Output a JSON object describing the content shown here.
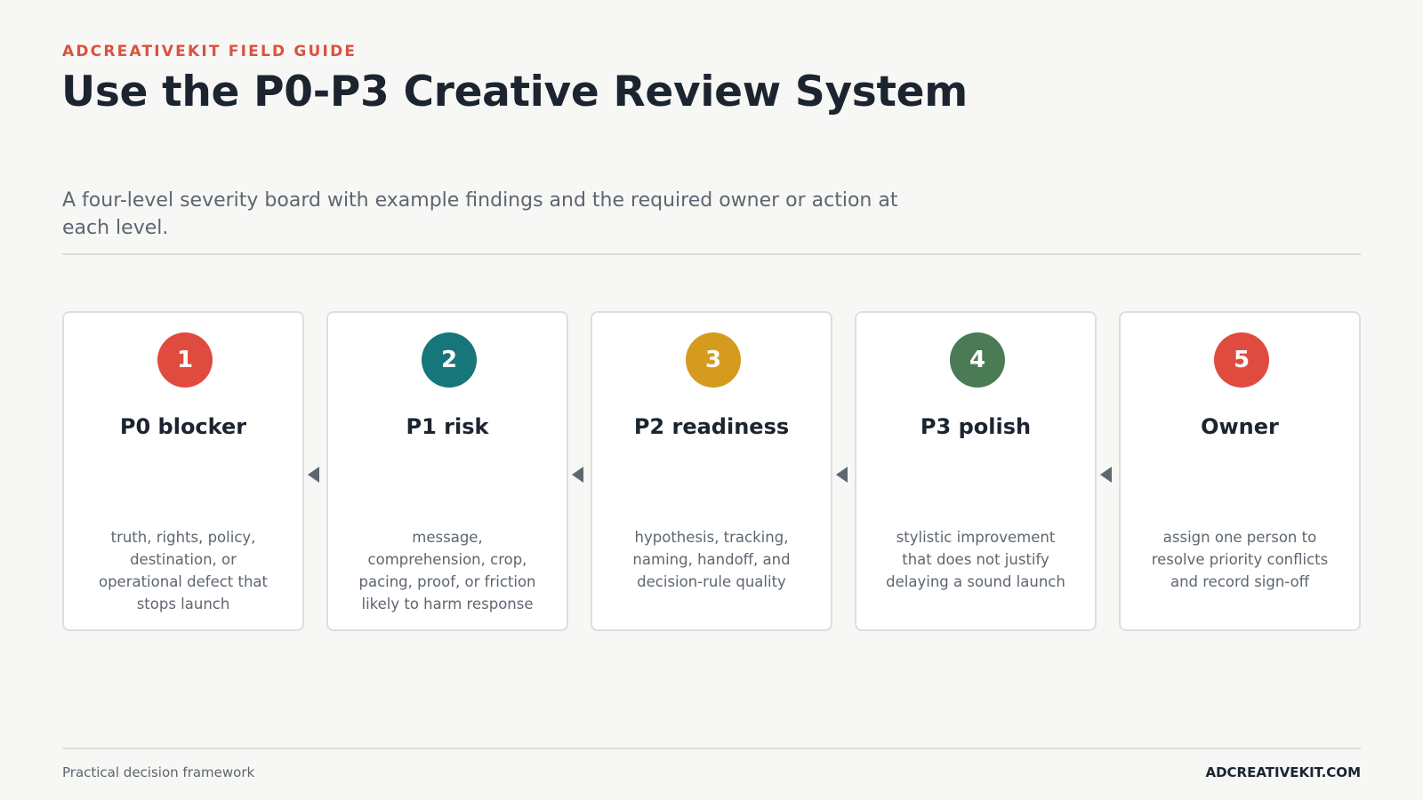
{
  "header": {
    "eyebrow": "ADCREATIVEKIT FIELD GUIDE",
    "title": "Use the P0-P3 Creative Review System",
    "subtitle": "A four-level severity board with example findings and the required owner or action at each level."
  },
  "cards": [
    {
      "number": "1",
      "title": "P0 blocker",
      "description": "truth, rights, policy, destination, or operational defect that stops launch",
      "color": "#e04b3f"
    },
    {
      "number": "2",
      "title": "P1 risk",
      "description": "message, comprehension, crop, pacing, proof, or friction likely to harm response",
      "color": "#16767a"
    },
    {
      "number": "3",
      "title": "P2 readiness",
      "description": "hypothesis, tracking, naming, handoff, and decision-rule quality",
      "color": "#d49b1f"
    },
    {
      "number": "4",
      "title": "P3 polish",
      "description": "stylistic improvement that does not justify delaying a sound launch",
      "color": "#4b7b55"
    },
    {
      "number": "5",
      "title": "Owner",
      "description": "assign one person to resolve priority conflicts and record sign-off",
      "color": "#e04b3f"
    }
  ],
  "arrows": [
    {
      "icon": "arrow-left-icon",
      "color": "#5e666e"
    },
    {
      "icon": "arrow-left-icon",
      "color": "#5e666e"
    },
    {
      "icon": "arrow-left-icon",
      "color": "#5e666e"
    },
    {
      "icon": "arrow-left-icon",
      "color": "#5e666e"
    }
  ],
  "footer": {
    "left": "Practical decision framework",
    "right": "ADCREATIVEKIT.COM"
  }
}
